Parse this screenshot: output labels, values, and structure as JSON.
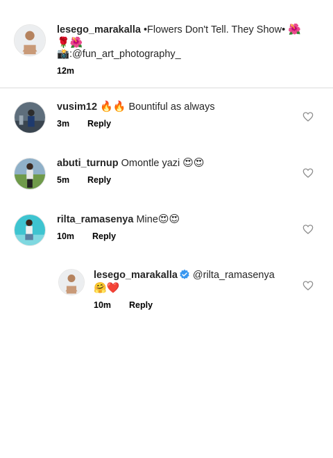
{
  "caption": {
    "username": "lesego_marakalla",
    "text_line1": "•Flowers Don't Tell. They Show•",
    "emoji_line1": "🌺",
    "emoji_line2": "🌹🌺",
    "credit": "📸:@fun_art_photography_",
    "time": "12m"
  },
  "comments": [
    {
      "username": "vusim12",
      "emoji": "🔥🔥",
      "text": "Bountiful as always",
      "time": "3m",
      "reply_label": "Reply"
    },
    {
      "username": "abuti_turnup",
      "text": "Omontle yazi",
      "emoji": "😍😍",
      "time": "5m",
      "reply_label": "Reply"
    },
    {
      "username": "rilta_ramasenya",
      "text": "Mine",
      "emoji": "😍😍",
      "time": "10m",
      "reply_label": "Reply"
    }
  ],
  "reply": {
    "username": "lesego_marakalla",
    "mention": "@rilta_ramasenya",
    "emoji": "🤗❤️",
    "time": "10m",
    "reply_label": "Reply"
  },
  "colors": {
    "verified": "#3897f0",
    "divider": "#dbdbdb",
    "heart_outline": "#8e8e8e"
  }
}
